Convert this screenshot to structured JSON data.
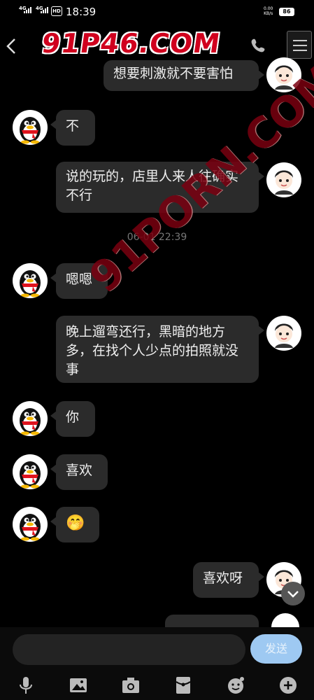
{
  "status_bar": {
    "network1": "4G",
    "network2": "4G",
    "hd": "HD",
    "time": "18:39",
    "speed_value": "0.00",
    "speed_unit": "KB/s",
    "battery": "86"
  },
  "watermarks": {
    "top": "91P46.COM",
    "diagonal": "91PORN.COM"
  },
  "messages": [
    {
      "side": "right",
      "text": "想要刺激就不要害怕"
    },
    {
      "side": "left",
      "text": "不"
    },
    {
      "side": "right",
      "text": "说的玩的，店里人来人往确实不行"
    },
    {
      "side": "left",
      "text": "嗯嗯"
    },
    {
      "side": "right",
      "text": "晚上遛弯还行，黑暗的地方多，在找个人少点的拍照就没事"
    },
    {
      "side": "left",
      "text": "你"
    },
    {
      "side": "left",
      "text": "喜欢"
    },
    {
      "side": "left",
      "text": "🤭"
    },
    {
      "side": "right",
      "text": "喜欢呀"
    }
  ],
  "timestamp": "06-01 22:39",
  "composer": {
    "send_label": "发送"
  },
  "toolbar": [
    "voice-icon",
    "image-icon",
    "camera-icon",
    "red-packet-icon",
    "emoji-icon",
    "plus-icon"
  ]
}
